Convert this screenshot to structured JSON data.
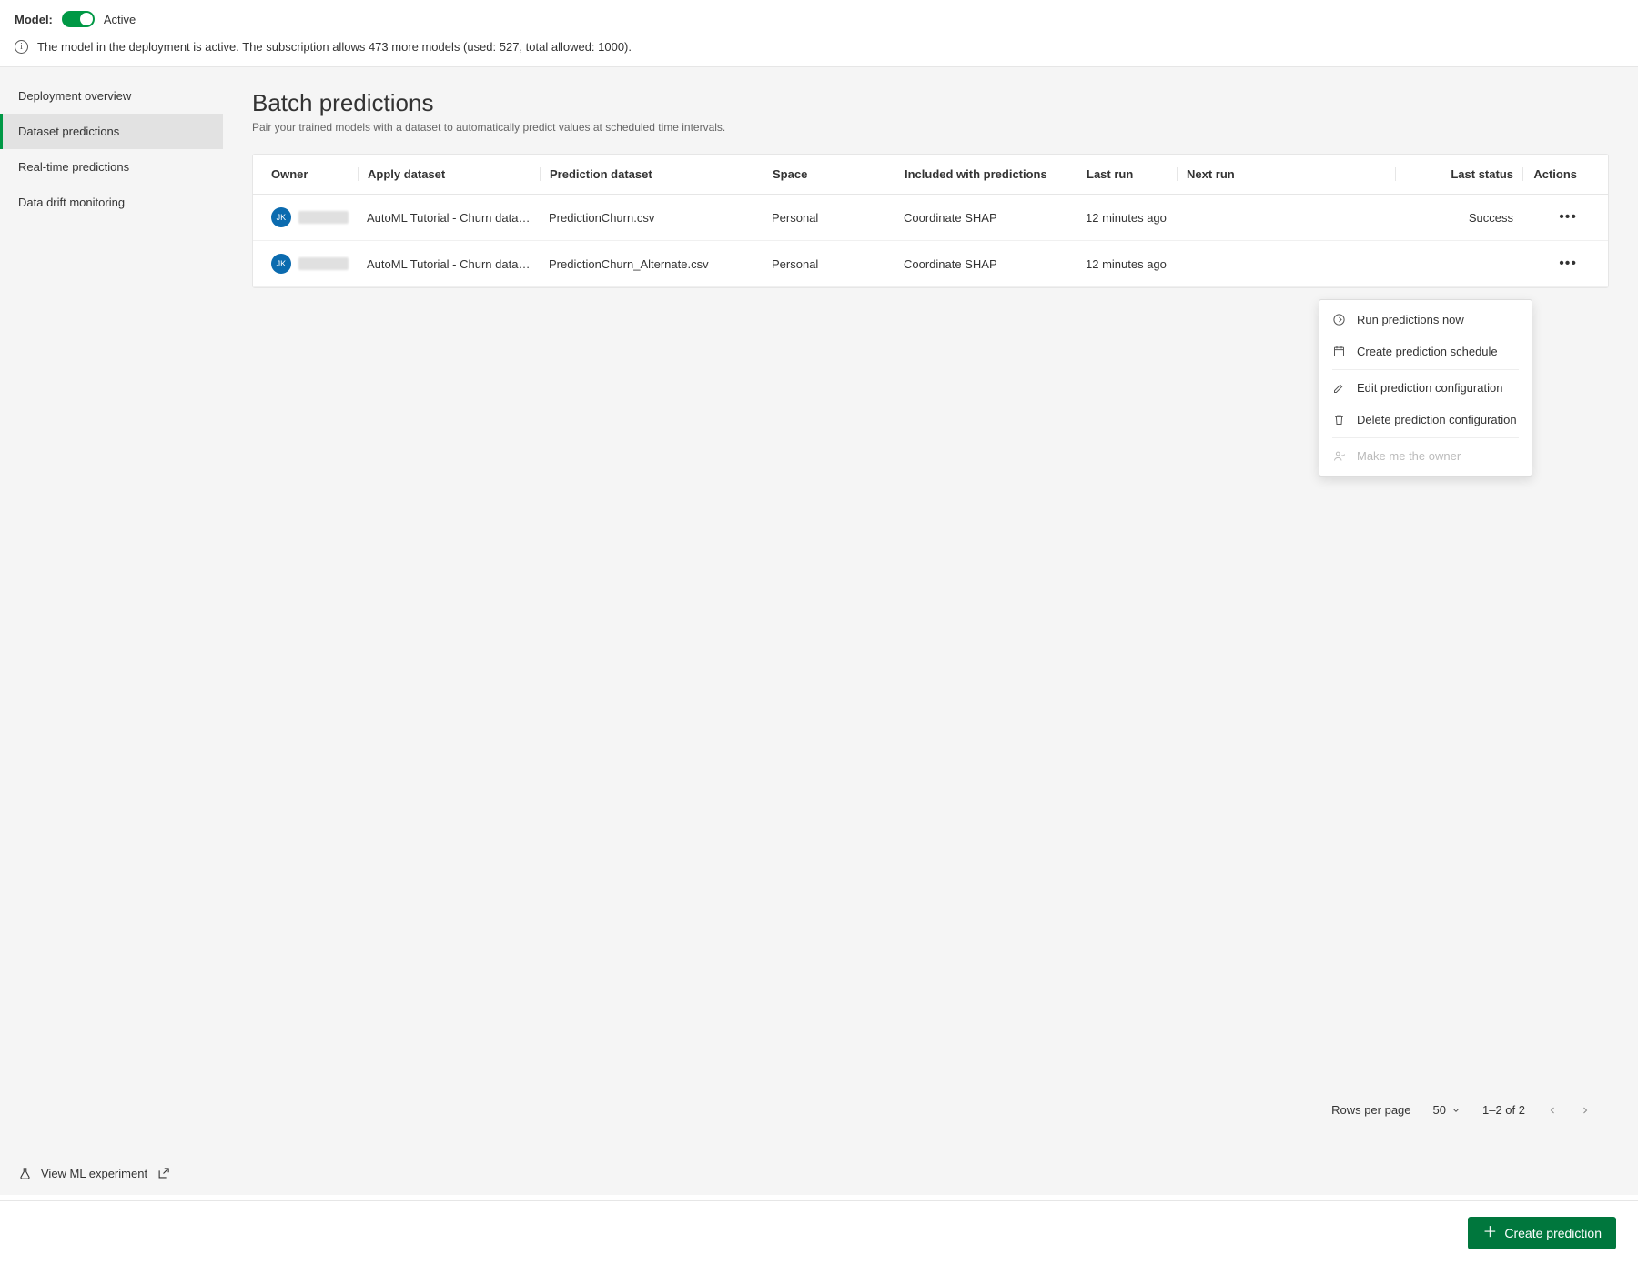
{
  "header": {
    "model_label": "Model:",
    "toggle_status": "Active",
    "info_text": "The model in the deployment is active. The subscription allows 473 more models (used: 527, total allowed: 1000)."
  },
  "sidebar": {
    "items": [
      {
        "label": "Deployment overview"
      },
      {
        "label": "Dataset predictions"
      },
      {
        "label": "Real-time predictions"
      },
      {
        "label": "Data drift monitoring"
      }
    ],
    "footer_link": "View ML experiment"
  },
  "page": {
    "title": "Batch predictions",
    "subtitle": "Pair your trained models with a dataset to automatically predict values at scheduled time intervals."
  },
  "table": {
    "columns": {
      "owner": "Owner",
      "apply": "Apply dataset",
      "pred": "Prediction dataset",
      "space": "Space",
      "incl": "Included with predictions",
      "lastrun": "Last run",
      "nextrun": "Next run",
      "status": "Last status",
      "actions": "Actions"
    },
    "rows": [
      {
        "owner_initials": "JK",
        "apply_dataset": "AutoML Tutorial - Churn data - ap",
        "prediction_dataset": "PredictionChurn.csv",
        "space": "Personal",
        "included": "Coordinate SHAP",
        "last_run": "12 minutes ago",
        "next_run": "",
        "status": "Success"
      },
      {
        "owner_initials": "JK",
        "apply_dataset": "AutoML Tutorial - Churn data - ap",
        "prediction_dataset": "PredictionChurn_Alternate.csv",
        "space": "Personal",
        "included": "Coordinate SHAP",
        "last_run": "12 minutes ago",
        "next_run": "",
        "status": ""
      }
    ]
  },
  "dropdown": {
    "run_now": "Run predictions now",
    "create_schedule": "Create prediction schedule",
    "edit_config": "Edit prediction configuration",
    "delete_config": "Delete prediction configuration",
    "make_owner": "Make me the owner"
  },
  "pagination": {
    "rows_label": "Rows per page",
    "rows_value": "50",
    "range": "1–2 of 2"
  },
  "footer": {
    "create_button": "Create prediction"
  }
}
